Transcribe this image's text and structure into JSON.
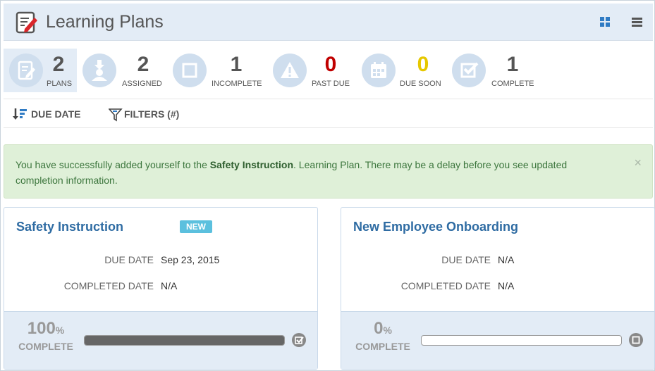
{
  "header": {
    "title": "Learning Plans",
    "icons": {
      "logo": "edit-document-icon",
      "grid_view": "grid-view-icon",
      "list_view": "list-view-icon"
    }
  },
  "stats": [
    {
      "key": "plans",
      "count": "2",
      "label": "PLANS",
      "icon": "document-icon",
      "color": "#555555",
      "active": true
    },
    {
      "key": "assigned",
      "count": "2",
      "label": "ASSIGNED",
      "icon": "user-download-icon",
      "color": "#555555"
    },
    {
      "key": "incomplete",
      "count": "1",
      "label": "INCOMPLETE",
      "icon": "square-icon",
      "color": "#555555"
    },
    {
      "key": "past_due",
      "count": "0",
      "label": "PAST DUE",
      "icon": "warning-icon",
      "color": "#c00000"
    },
    {
      "key": "due_soon",
      "count": "0",
      "label": "DUE SOON",
      "icon": "calendar-icon",
      "color": "#e6c800"
    },
    {
      "key": "complete",
      "count": "1",
      "label": "COMPLETE",
      "icon": "checkbox-icon",
      "color": "#555555"
    }
  ],
  "toolbar": {
    "sort_label": "DUE DATE",
    "filter_label": "FILTERS (#)"
  },
  "alert": {
    "prefix": "You have successfully added yourself to the ",
    "plan": "Safety Instruction",
    "suffix": ". Learning Plan. There may be a delay before you see updated completion information.",
    "close": "×"
  },
  "cards": [
    {
      "title": "Safety Instruction",
      "badge": "NEW",
      "due_label": "DUE DATE",
      "due_value": "Sep 23, 2015",
      "completed_label": "COMPLETED DATE",
      "completed_value": "N/A",
      "percent": "100",
      "percent_sign": "%",
      "complete_label": "COMPLETE",
      "progress": 1.0,
      "status_icon": "checked-circle-icon"
    },
    {
      "title": "New Employee Onboarding",
      "due_label": "DUE DATE",
      "due_value": "N/A",
      "completed_label": "COMPLETED DATE",
      "completed_value": "N/A",
      "percent": "0",
      "percent_sign": "%",
      "complete_label": "COMPLETE",
      "progress": 0.0,
      "status_icon": "stop-circle-icon"
    }
  ],
  "colors": {
    "accent": "#2f6ca3",
    "header_bg": "#e3ecf6",
    "alert_bg": "#dff0d8",
    "badge": "#5bc0de"
  }
}
